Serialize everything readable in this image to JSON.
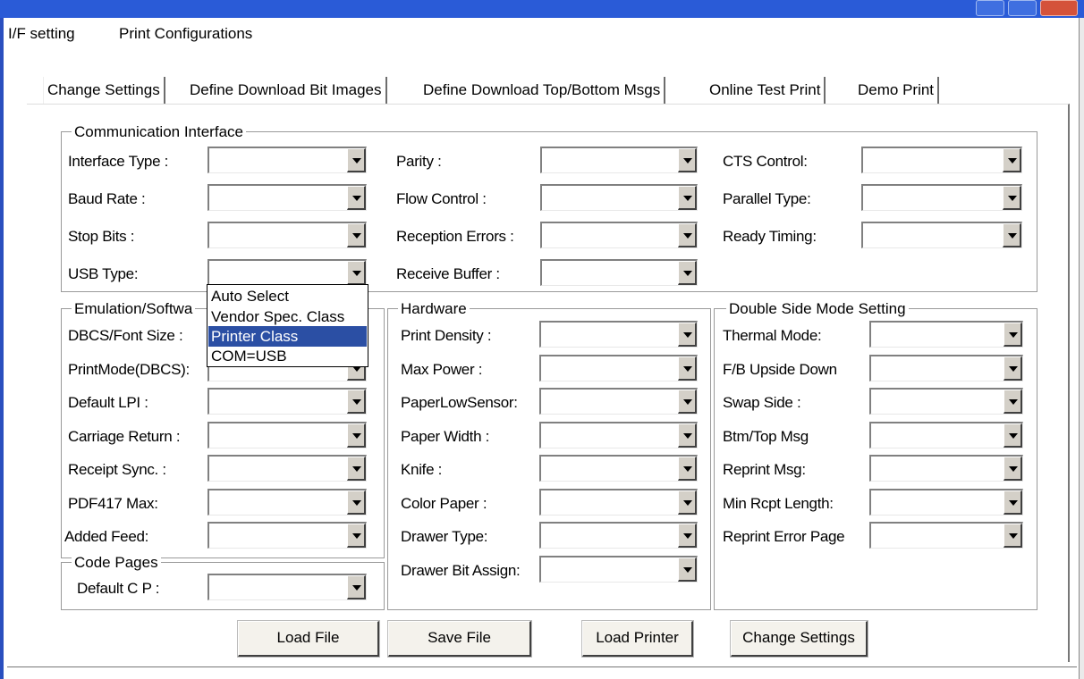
{
  "menu": [
    "I/F setting",
    "Print Configurations"
  ],
  "tabs": [
    "Change Settings",
    "Define Download Bit Images",
    "Define Download Top/Bottom Msgs",
    "Online Test Print",
    "Demo Print"
  ],
  "comm": {
    "title": "Communication Interface",
    "col1": [
      "Interface Type :",
      "Baud Rate :",
      "Stop Bits :",
      "USB Type:"
    ],
    "col2": [
      "Parity :",
      "Flow Control :",
      "Reception Errors :",
      "Receive Buffer :"
    ],
    "col3": [
      "CTS Control:",
      "Parallel Type:",
      "Ready Timing:"
    ]
  },
  "emulation": {
    "title": "Emulation/Softwa",
    "labels": [
      "DBCS/Font Size :",
      "PrintMode(DBCS):",
      "Default LPI :",
      "Carriage Return :",
      "Receipt Sync. :",
      "PDF417 Max:",
      "Added Feed:"
    ]
  },
  "codepages": {
    "title": "Code Pages",
    "label": "Default C P :"
  },
  "hardware": {
    "title": "Hardware",
    "labels": [
      "Print Density :",
      "Max Power :",
      "PaperLowSensor:",
      "Paper Width :",
      "Knife :",
      "Color Paper :",
      "Drawer Type:",
      "Drawer Bit Assign:"
    ]
  },
  "double": {
    "title": "Double Side Mode Setting",
    "labels": [
      "Thermal Mode:",
      "F/B Upside Down",
      "Swap Side :",
      "Btm/Top Msg",
      "Reprint Msg:",
      "Min Rcpt Length:",
      "Reprint Error Page"
    ]
  },
  "usb_dropdown": {
    "options": [
      "Auto Select",
      "Vendor Spec. Class",
      "Printer Class",
      "COM=USB"
    ],
    "selected": "Printer Class"
  },
  "buttons": [
    "Load File",
    "Save File",
    "Load Printer",
    "Change Settings"
  ],
  "icons": {
    "combo_arrow": "chevron-down-icon"
  },
  "colors": {
    "selection": "#2b4fa4",
    "titlebar": "#2a5bd7"
  }
}
